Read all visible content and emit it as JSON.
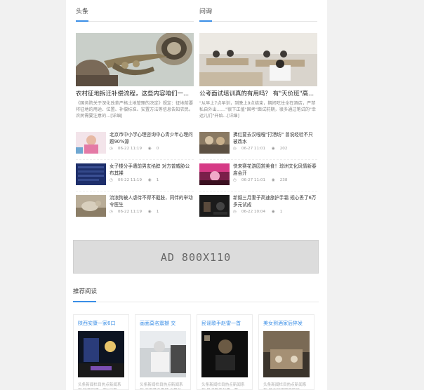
{
  "headlines": {
    "title": "头条",
    "hero": {
      "title": "农村征地拆迁补偿流程，这些内容咱们一...",
      "desc": "《国务院关于深化改革严格土地管理的决定》规定：征地前要将征地的用途、位置、补偿标准、安置方法等信息告知农民。农民需要注意的...[详细]"
    },
    "items": [
      {
        "title": "北京市中小学心理咨询中心青少年心理问题90%源",
        "time": "06-22 11:19",
        "views": "0"
      },
      {
        "title": "女子楼分手遭前男友掐脖 对方曾威胁公布其裸",
        "time": "06-22 11:19",
        "views": "1"
      },
      {
        "title": "流浪狗被人虐待不得不截肢，同伴的举动令医生",
        "time": "06-22 11:19",
        "views": "1"
      }
    ]
  },
  "qa": {
    "title": "问询",
    "hero": {
      "title": "公考面试培训真的有用吗？ 有\"天价班\"高...",
      "desc": "\"从早上7点早训，到晚上9点结束，期间吃住全在酒店，严禁私自外出……\"很下正值\"国考\"面试前期，很多通过笔试的\"幸运儿们\"开始...[详细]"
    },
    "items": [
      {
        "title": "拂红要去汉嘎嘎\"打酒坊\" 曾说经验不只被改水",
        "time": "06-27 11:01",
        "views": "202"
      },
      {
        "title": "快来赛花游园赏美食！琼洲文化风情新春庙会开",
        "time": "06-27 11:01",
        "views": "238"
      },
      {
        "title": "新婚三月妻子高速旅护手霜 规心丢了6万多元试成",
        "time": "06-22 10:04",
        "views": "1"
      }
    ]
  },
  "ad": {
    "label": "AD 800X110"
  },
  "recommend": {
    "title": "推荐阅读",
    "cards": [
      {
        "title": "陕西安康一家6口",
        "desc": "头条新闻栏目热点新闻系列,陕西安康一家6口事"
      },
      {
        "title": "画面莫名震撼 交",
        "desc": "头条新闻栏目热点新闻系列,画面莫名震撼 交警处"
      },
      {
        "title": "民谣歌手赵雷一首",
        "desc": "头条新闻栏目热点新闻系列,民谣歌手赵雷一首"
      },
      {
        "title": "美女到酒家后猝发",
        "desc": "头条新闻栏目热点新闻系列,美女到酒家后猝发"
      }
    ]
  },
  "icons": {
    "clock": "clock-icon",
    "eye": "eye-icon"
  },
  "colors": {
    "accent": "#3a8ee6",
    "background": "#f1f1f1",
    "ad_bg": "#dcdcdc"
  }
}
